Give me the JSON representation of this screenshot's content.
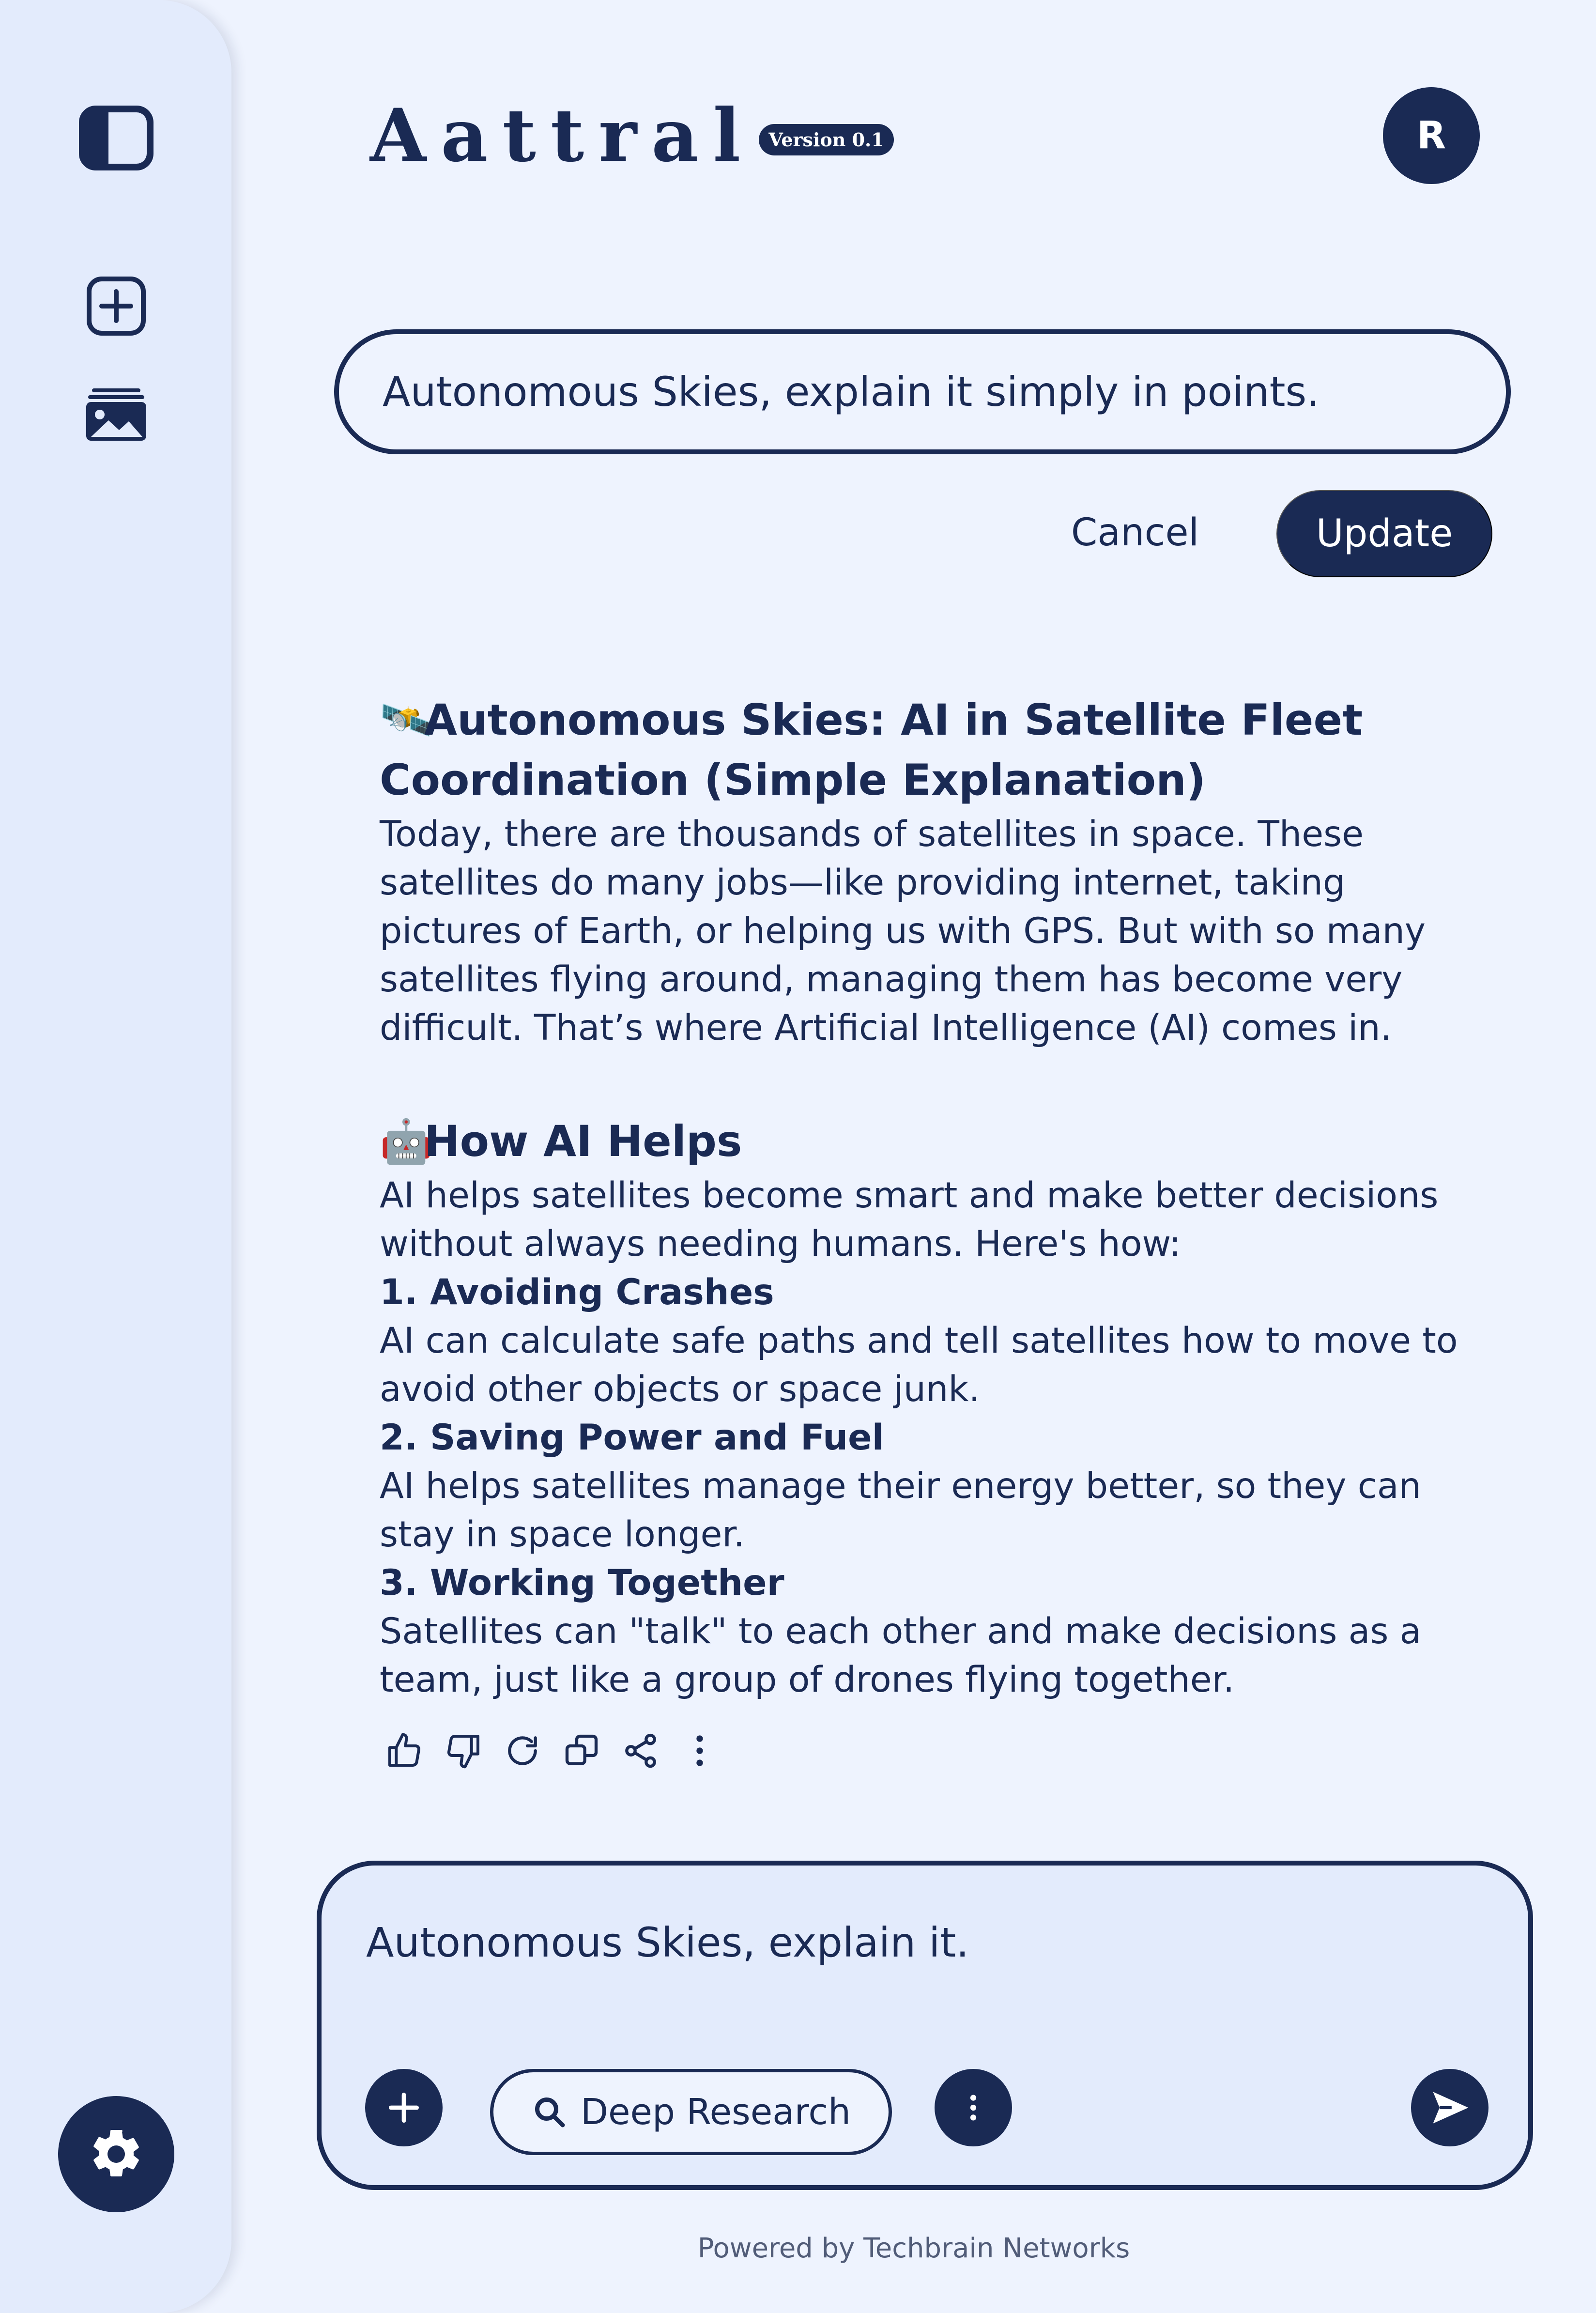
{
  "sidebar": {
    "items": [
      {
        "icon": "sidebar-toggle-icon"
      },
      {
        "icon": "new-chat-icon"
      },
      {
        "icon": "gallery-icon"
      }
    ],
    "settings_icon": "gear-icon"
  },
  "header": {
    "brand": "Aattral",
    "version": "Version 0.1",
    "avatar_initial": "R"
  },
  "edit": {
    "prompt": "Autonomous Skies, explain it simply in points.",
    "cancel_label": "Cancel",
    "update_label": "Update"
  },
  "answer": {
    "title_emoji": "🛰️",
    "title": "Autonomous Skies: AI in Satellite Fleet Coordination (Simple Explanation)",
    "intro": "Today, there are thousands of satellites in space. These satellites do many jobs—like providing internet, taking pictures of Earth, or helping us with GPS. But with so many satellites flying around, managing them has become very difficult. That’s where Artificial Intelligence (AI) comes in.",
    "section_emoji": "🤖",
    "section_title": "How AI Helps",
    "section_intro": "AI helps satellites become smart and make better decisions without always needing humans. Here's how:",
    "points": [
      {
        "title": "1. Avoiding Crashes",
        "text": "AI can calculate safe paths and tell satellites how to move to avoid other objects or space junk."
      },
      {
        "title": "2. Saving Power and Fuel",
        "text": "AI helps satellites manage their energy better, so they can stay in space longer."
      },
      {
        "title": "3. Working Together",
        "text": "Satellites can \"talk\" to each other and make decisions as a team, just like a group of drones flying together."
      }
    ],
    "actions": [
      "thumbs-up-icon",
      "thumbs-down-icon",
      "regenerate-icon",
      "copy-icon",
      "share-icon",
      "more-vertical-icon"
    ]
  },
  "composer": {
    "text": "Autonomous Skies, explain it.",
    "deep_research_label": "Deep Research"
  },
  "footer": {
    "text": "Powered by Techbrain Networks"
  },
  "colors": {
    "primary": "#1a2a54",
    "background": "#eef3fe",
    "sidebar": "#e3ebfc"
  }
}
